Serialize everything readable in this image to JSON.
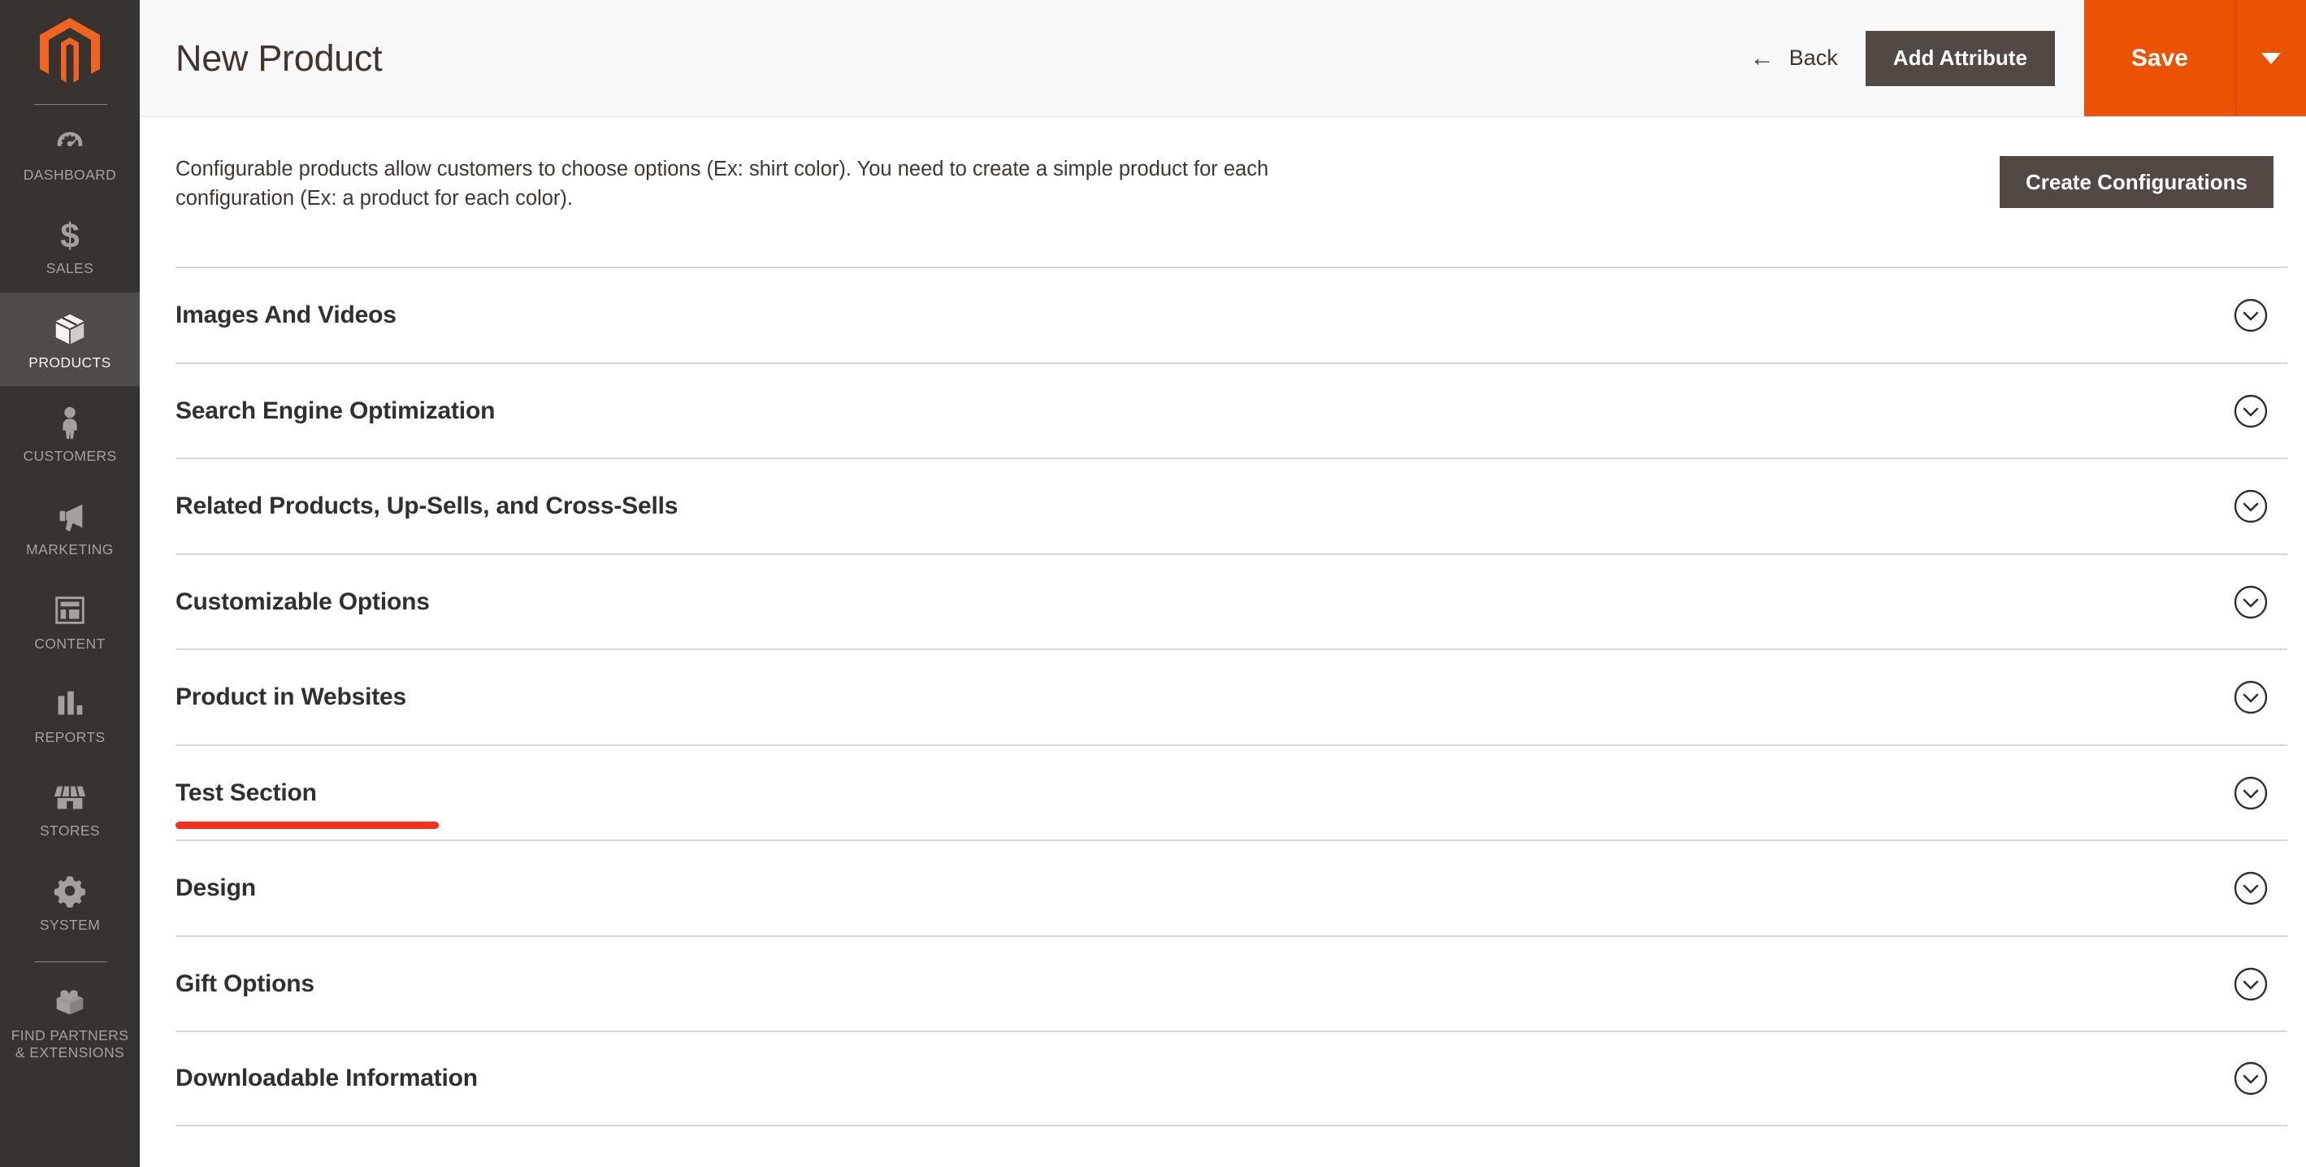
{
  "sidebar": {
    "logo": "magento-logo",
    "items": [
      {
        "label": "DASHBOARD",
        "icon": "dashboard-gauge-icon",
        "active": false
      },
      {
        "label": "SALES",
        "icon": "dollar-sign-icon",
        "active": false
      },
      {
        "label": "PRODUCTS",
        "icon": "box-icon",
        "active": true
      },
      {
        "label": "CUSTOMERS",
        "icon": "person-icon",
        "active": false
      },
      {
        "label": "MARKETING",
        "icon": "megaphone-icon",
        "active": false
      },
      {
        "label": "CONTENT",
        "icon": "layout-icon",
        "active": false
      },
      {
        "label": "REPORTS",
        "icon": "bar-chart-icon",
        "active": false
      },
      {
        "label": "STORES",
        "icon": "storefront-icon",
        "active": false
      },
      {
        "label": "SYSTEM",
        "icon": "gear-icon",
        "active": false
      },
      {
        "label": "FIND PARTNERS\n& EXTENSIONS",
        "icon": "lego-brick-icon",
        "active": false
      }
    ]
  },
  "header": {
    "title": "New Product",
    "back_label": "Back",
    "back_icon": "arrow-left-icon",
    "add_attribute_label": "Add Attribute",
    "save_label": "Save",
    "save_toggle_icon": "caret-down-icon"
  },
  "content": {
    "intro_text": "Configurable products allow customers to choose options (Ex: shirt color). You need to create a simple product for each configuration (Ex: a product for each color).",
    "create_configurations_label": "Create Configurations",
    "sections": [
      {
        "title": "Images And Videos",
        "icon": "chevron-down-circle-icon",
        "annotated": false
      },
      {
        "title": "Search Engine Optimization",
        "icon": "chevron-down-circle-icon",
        "annotated": false
      },
      {
        "title": "Related Products, Up-Sells, and Cross-Sells",
        "icon": "chevron-down-circle-icon",
        "annotated": false
      },
      {
        "title": "Customizable Options",
        "icon": "chevron-down-circle-icon",
        "annotated": false
      },
      {
        "title": "Product in Websites",
        "icon": "chevron-down-circle-icon",
        "annotated": false
      },
      {
        "title": "Test Section",
        "icon": "chevron-down-circle-icon",
        "annotated": true
      },
      {
        "title": "Design",
        "icon": "chevron-down-circle-icon",
        "annotated": false
      },
      {
        "title": "Gift Options",
        "icon": "chevron-down-circle-icon",
        "annotated": false
      },
      {
        "title": "Downloadable Information",
        "icon": "chevron-down-circle-icon",
        "annotated": false
      }
    ]
  },
  "colors": {
    "brand_orange": "#eb5202",
    "sidebar_bg": "#373330",
    "sidebar_active_bg": "#4f4b48",
    "button_dark": "#514943",
    "annotation_red": "#f92f16",
    "header_bg": "#f8f8f8"
  }
}
